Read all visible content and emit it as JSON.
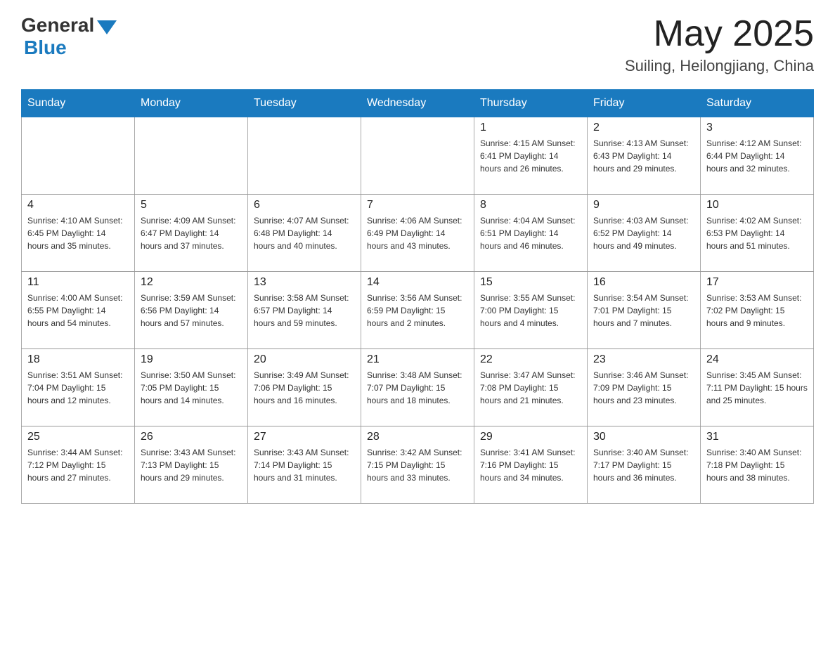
{
  "header": {
    "logo_general": "General",
    "logo_blue": "Blue",
    "month_year": "May 2025",
    "location": "Suiling, Heilongjiang, China"
  },
  "days_of_week": [
    "Sunday",
    "Monday",
    "Tuesday",
    "Wednesday",
    "Thursday",
    "Friday",
    "Saturday"
  ],
  "weeks": [
    [
      {
        "day": "",
        "info": ""
      },
      {
        "day": "",
        "info": ""
      },
      {
        "day": "",
        "info": ""
      },
      {
        "day": "",
        "info": ""
      },
      {
        "day": "1",
        "info": "Sunrise: 4:15 AM\nSunset: 6:41 PM\nDaylight: 14 hours\nand 26 minutes."
      },
      {
        "day": "2",
        "info": "Sunrise: 4:13 AM\nSunset: 6:43 PM\nDaylight: 14 hours\nand 29 minutes."
      },
      {
        "day": "3",
        "info": "Sunrise: 4:12 AM\nSunset: 6:44 PM\nDaylight: 14 hours\nand 32 minutes."
      }
    ],
    [
      {
        "day": "4",
        "info": "Sunrise: 4:10 AM\nSunset: 6:45 PM\nDaylight: 14 hours\nand 35 minutes."
      },
      {
        "day": "5",
        "info": "Sunrise: 4:09 AM\nSunset: 6:47 PM\nDaylight: 14 hours\nand 37 minutes."
      },
      {
        "day": "6",
        "info": "Sunrise: 4:07 AM\nSunset: 6:48 PM\nDaylight: 14 hours\nand 40 minutes."
      },
      {
        "day": "7",
        "info": "Sunrise: 4:06 AM\nSunset: 6:49 PM\nDaylight: 14 hours\nand 43 minutes."
      },
      {
        "day": "8",
        "info": "Sunrise: 4:04 AM\nSunset: 6:51 PM\nDaylight: 14 hours\nand 46 minutes."
      },
      {
        "day": "9",
        "info": "Sunrise: 4:03 AM\nSunset: 6:52 PM\nDaylight: 14 hours\nand 49 minutes."
      },
      {
        "day": "10",
        "info": "Sunrise: 4:02 AM\nSunset: 6:53 PM\nDaylight: 14 hours\nand 51 minutes."
      }
    ],
    [
      {
        "day": "11",
        "info": "Sunrise: 4:00 AM\nSunset: 6:55 PM\nDaylight: 14 hours\nand 54 minutes."
      },
      {
        "day": "12",
        "info": "Sunrise: 3:59 AM\nSunset: 6:56 PM\nDaylight: 14 hours\nand 57 minutes."
      },
      {
        "day": "13",
        "info": "Sunrise: 3:58 AM\nSunset: 6:57 PM\nDaylight: 14 hours\nand 59 minutes."
      },
      {
        "day": "14",
        "info": "Sunrise: 3:56 AM\nSunset: 6:59 PM\nDaylight: 15 hours\nand 2 minutes."
      },
      {
        "day": "15",
        "info": "Sunrise: 3:55 AM\nSunset: 7:00 PM\nDaylight: 15 hours\nand 4 minutes."
      },
      {
        "day": "16",
        "info": "Sunrise: 3:54 AM\nSunset: 7:01 PM\nDaylight: 15 hours\nand 7 minutes."
      },
      {
        "day": "17",
        "info": "Sunrise: 3:53 AM\nSunset: 7:02 PM\nDaylight: 15 hours\nand 9 minutes."
      }
    ],
    [
      {
        "day": "18",
        "info": "Sunrise: 3:51 AM\nSunset: 7:04 PM\nDaylight: 15 hours\nand 12 minutes."
      },
      {
        "day": "19",
        "info": "Sunrise: 3:50 AM\nSunset: 7:05 PM\nDaylight: 15 hours\nand 14 minutes."
      },
      {
        "day": "20",
        "info": "Sunrise: 3:49 AM\nSunset: 7:06 PM\nDaylight: 15 hours\nand 16 minutes."
      },
      {
        "day": "21",
        "info": "Sunrise: 3:48 AM\nSunset: 7:07 PM\nDaylight: 15 hours\nand 18 minutes."
      },
      {
        "day": "22",
        "info": "Sunrise: 3:47 AM\nSunset: 7:08 PM\nDaylight: 15 hours\nand 21 minutes."
      },
      {
        "day": "23",
        "info": "Sunrise: 3:46 AM\nSunset: 7:09 PM\nDaylight: 15 hours\nand 23 minutes."
      },
      {
        "day": "24",
        "info": "Sunrise: 3:45 AM\nSunset: 7:11 PM\nDaylight: 15 hours\nand 25 minutes."
      }
    ],
    [
      {
        "day": "25",
        "info": "Sunrise: 3:44 AM\nSunset: 7:12 PM\nDaylight: 15 hours\nand 27 minutes."
      },
      {
        "day": "26",
        "info": "Sunrise: 3:43 AM\nSunset: 7:13 PM\nDaylight: 15 hours\nand 29 minutes."
      },
      {
        "day": "27",
        "info": "Sunrise: 3:43 AM\nSunset: 7:14 PM\nDaylight: 15 hours\nand 31 minutes."
      },
      {
        "day": "28",
        "info": "Sunrise: 3:42 AM\nSunset: 7:15 PM\nDaylight: 15 hours\nand 33 minutes."
      },
      {
        "day": "29",
        "info": "Sunrise: 3:41 AM\nSunset: 7:16 PM\nDaylight: 15 hours\nand 34 minutes."
      },
      {
        "day": "30",
        "info": "Sunrise: 3:40 AM\nSunset: 7:17 PM\nDaylight: 15 hours\nand 36 minutes."
      },
      {
        "day": "31",
        "info": "Sunrise: 3:40 AM\nSunset: 7:18 PM\nDaylight: 15 hours\nand 38 minutes."
      }
    ]
  ]
}
